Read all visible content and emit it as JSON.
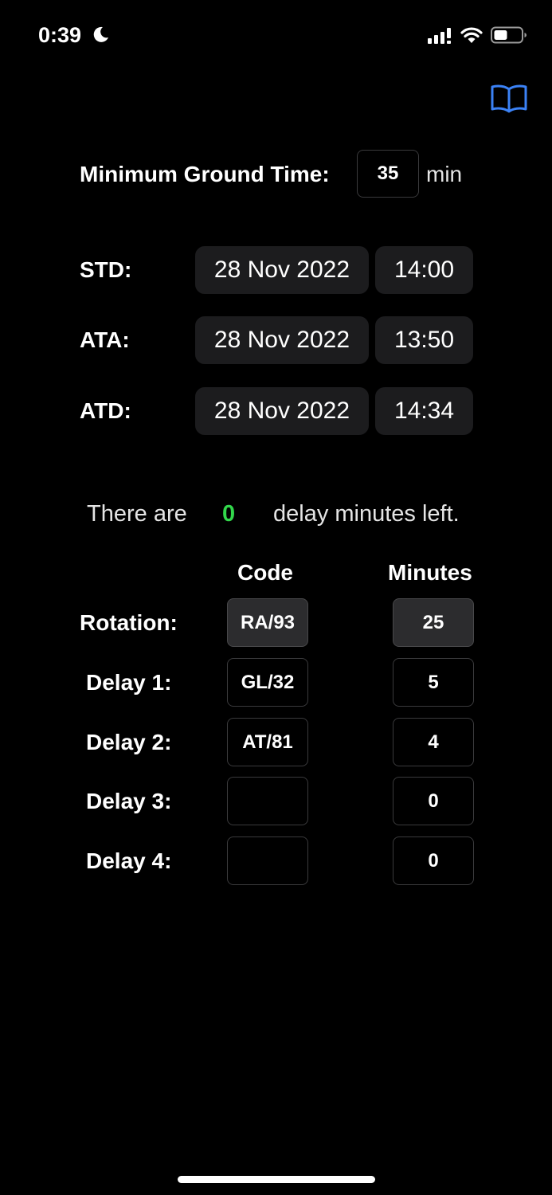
{
  "status_bar": {
    "time": "0:39",
    "icons": [
      "moon-icon",
      "cellular-signal-icon",
      "wifi-icon",
      "battery-icon"
    ]
  },
  "header": {
    "icon": "book-icon",
    "accent_color": "#3b82f6"
  },
  "mgt": {
    "label": "Minimum Ground Time:",
    "value": "35",
    "unit": "min"
  },
  "times": {
    "std": {
      "label": "STD:",
      "date": "28 Nov 2022",
      "time": "14:00"
    },
    "ata": {
      "label": "ATA:",
      "date": "28 Nov 2022",
      "time": "13:50"
    },
    "atd": {
      "label": "ATD:",
      "date": "28 Nov 2022",
      "time": "14:34"
    }
  },
  "summary": {
    "prefix": "There are",
    "value": "0",
    "suffix": "delay minutes left.",
    "value_color": "#32d74b"
  },
  "table": {
    "headers": {
      "code": "Code",
      "minutes": "Minutes"
    },
    "rows": [
      {
        "label": "Rotation:",
        "code": "RA/93",
        "minutes": "25"
      },
      {
        "label": "Delay 1:",
        "code": "GL/32",
        "minutes": "5"
      },
      {
        "label": "Delay 2:",
        "code": "AT/81",
        "minutes": "4"
      },
      {
        "label": "Delay 3:",
        "code": "",
        "minutes": "0"
      },
      {
        "label": "Delay 4:",
        "code": "",
        "minutes": "0"
      }
    ]
  }
}
